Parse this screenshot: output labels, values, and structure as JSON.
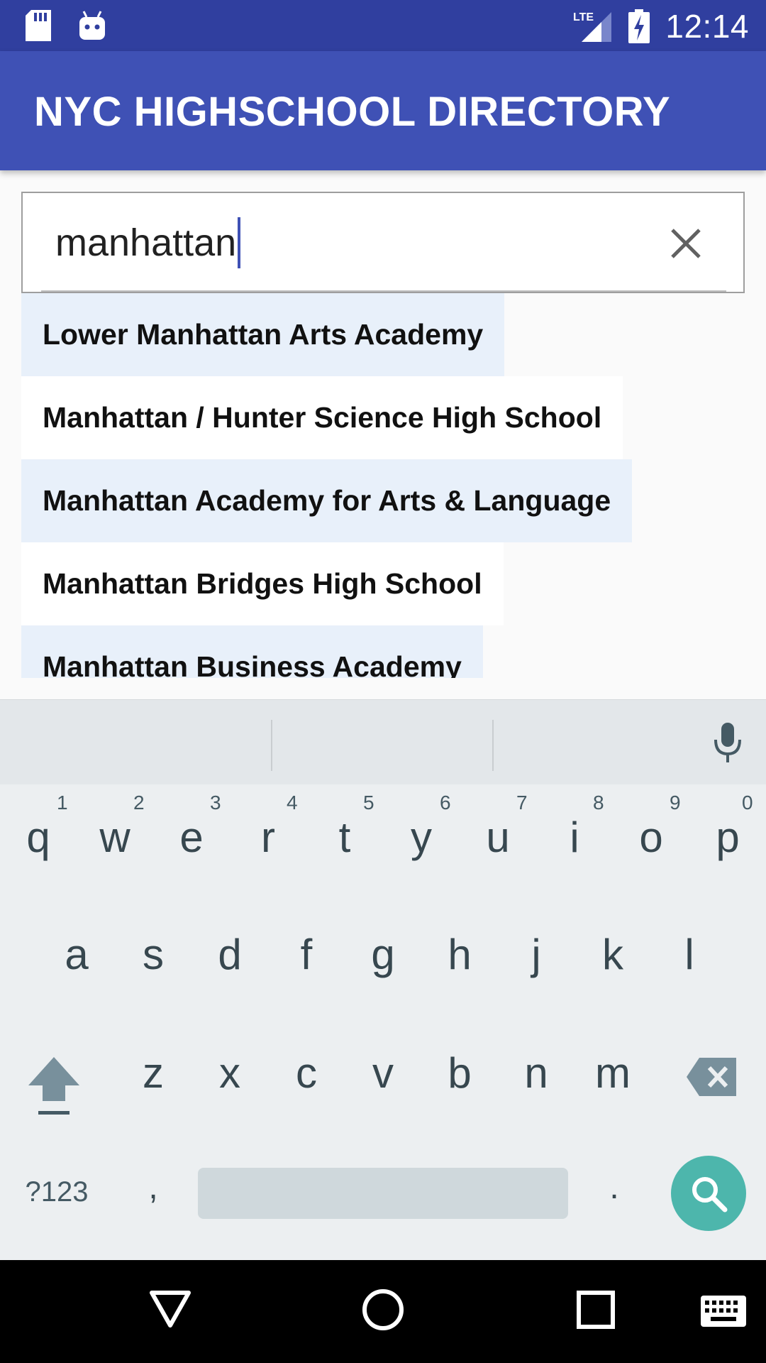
{
  "status_bar": {
    "time": "12:14",
    "network": "LTE",
    "icons": [
      "sd-card-icon",
      "android-debug-icon",
      "lte-signal-icon",
      "battery-charging-icon"
    ]
  },
  "app_bar": {
    "title": "NYC HIGHSCHOOL DIRECTORY"
  },
  "search": {
    "value": "manhattan",
    "clear_icon": "close-icon"
  },
  "suggestions": [
    "Lower Manhattan Arts Academy",
    "Manhattan / Hunter Science High School",
    "Manhattan Academy for Arts & Language",
    "Manhattan Bridges High School",
    "Manhattan Business Academy"
  ],
  "keyboard": {
    "row1": [
      "q",
      "w",
      "e",
      "r",
      "t",
      "y",
      "u",
      "i",
      "o",
      "p"
    ],
    "row1_nums": [
      "1",
      "2",
      "3",
      "4",
      "5",
      "6",
      "7",
      "8",
      "9",
      "0"
    ],
    "row2": [
      "a",
      "s",
      "d",
      "f",
      "g",
      "h",
      "j",
      "k",
      "l"
    ],
    "row3": [
      "z",
      "x",
      "c",
      "v",
      "b",
      "n",
      "m"
    ],
    "symbols_key": "?123",
    "comma_key": ",",
    "period_key": ".",
    "accent_color": "#4db6ac"
  },
  "nav_bar": {
    "icons": [
      "back-icon",
      "home-icon",
      "recents-icon",
      "keyboard-icon"
    ]
  }
}
